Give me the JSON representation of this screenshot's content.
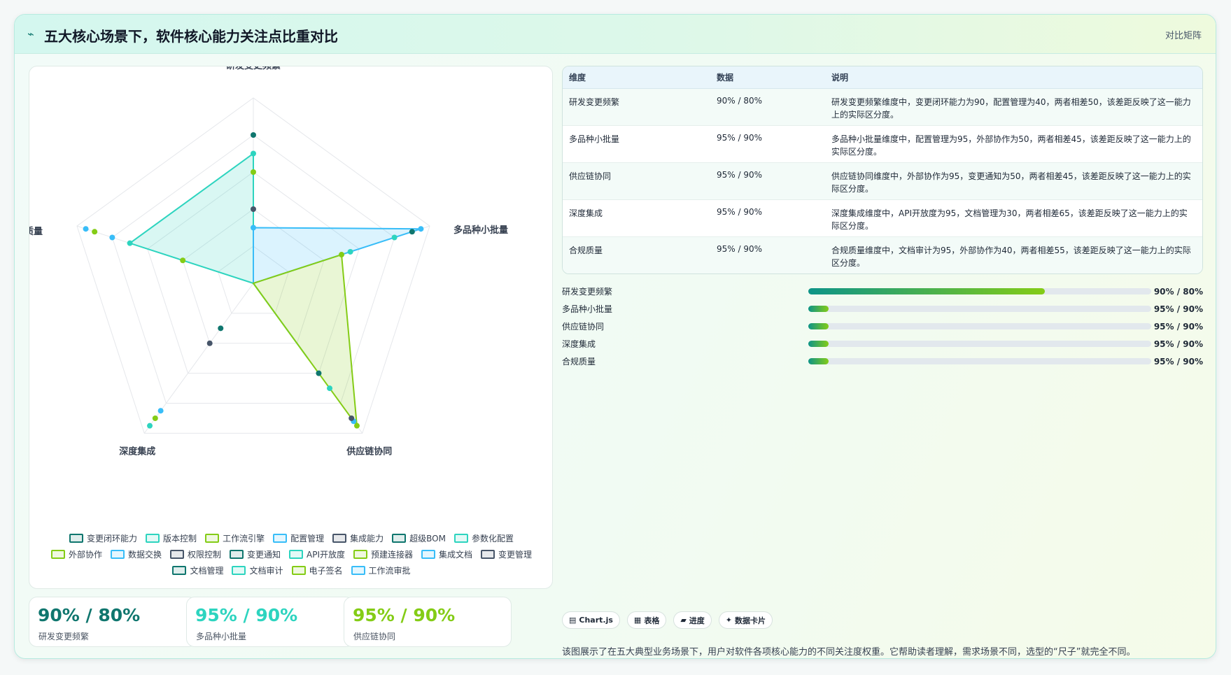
{
  "header": {
    "icon": "wave-icon",
    "title": "五大核心场景下，软件核心能力关注点比重对比",
    "tag": "对比矩阵"
  },
  "colors": {
    "teal_dark": "#0f766e",
    "teal": "#2dd4bf",
    "cyan": "#38bdf8",
    "green": "#84cc16",
    "slate": "#475569"
  },
  "chart_data": {
    "type": "radar",
    "axes": [
      "研发变更频繁",
      "多品种小批量",
      "供应链协同",
      "深度集成",
      "合规质量"
    ],
    "rmax": 100,
    "polygons": [
      {
        "values": [
          70,
          0,
          50,
          0,
          70
        ],
        "color": "#2dd4bf"
      },
      {
        "values": [
          30,
          95,
          0,
          0,
          0
        ],
        "color": "#38bdf8"
      },
      {
        "values": [
          0,
          50,
          95,
          0,
          0
        ],
        "color": "#84cc16"
      }
    ],
    "points": [
      {
        "axis": 0,
        "value": 80,
        "color": "#0f766e"
      },
      {
        "axis": 0,
        "value": 70,
        "color": "#2dd4bf"
      },
      {
        "axis": 0,
        "value": 60,
        "color": "#84cc16"
      },
      {
        "axis": 0,
        "value": 40,
        "color": "#475569"
      },
      {
        "axis": 0,
        "value": 30,
        "color": "#38bdf8"
      },
      {
        "axis": 1,
        "value": 95,
        "color": "#38bdf8"
      },
      {
        "axis": 1,
        "value": 90,
        "color": "#0f766e"
      },
      {
        "axis": 1,
        "value": 80,
        "color": "#2dd4bf"
      },
      {
        "axis": 1,
        "value": 55,
        "color": "#2dd4bf"
      },
      {
        "axis": 1,
        "value": 50,
        "color": "#84cc16"
      },
      {
        "axis": 2,
        "value": 95,
        "color": "#84cc16"
      },
      {
        "axis": 2,
        "value": 92,
        "color": "#38bdf8"
      },
      {
        "axis": 2,
        "value": 90,
        "color": "#475569"
      },
      {
        "axis": 2,
        "value": 70,
        "color": "#2dd4bf"
      },
      {
        "axis": 2,
        "value": 60,
        "color": "#0f766e"
      },
      {
        "axis": 3,
        "value": 95,
        "color": "#2dd4bf"
      },
      {
        "axis": 3,
        "value": 90,
        "color": "#84cc16"
      },
      {
        "axis": 3,
        "value": 85,
        "color": "#38bdf8"
      },
      {
        "axis": 3,
        "value": 40,
        "color": "#475569"
      },
      {
        "axis": 3,
        "value": 30,
        "color": "#0f766e"
      },
      {
        "axis": 4,
        "value": 95,
        "color": "#38bdf8"
      },
      {
        "axis": 4,
        "value": 90,
        "color": "#84cc16"
      },
      {
        "axis": 4,
        "value": 80,
        "color": "#38bdf8"
      },
      {
        "axis": 4,
        "value": 70,
        "color": "#2dd4bf"
      },
      {
        "axis": 4,
        "value": 40,
        "color": "#84cc16"
      }
    ],
    "legend": [
      {
        "name": "变更闭环能力",
        "color": "#0f766e"
      },
      {
        "name": "版本控制",
        "color": "#2dd4bf"
      },
      {
        "name": "工作流引擎",
        "color": "#84cc16"
      },
      {
        "name": "配置管理",
        "color": "#38bdf8"
      },
      {
        "name": "集成能力",
        "color": "#475569"
      },
      {
        "name": "超级BOM",
        "color": "#0f766e"
      },
      {
        "name": "参数化配置",
        "color": "#2dd4bf"
      },
      {
        "name": "外部协作",
        "color": "#84cc16"
      },
      {
        "name": "数据交换",
        "color": "#38bdf8"
      },
      {
        "name": "权限控制",
        "color": "#475569"
      },
      {
        "name": "变更通知",
        "color": "#0f766e"
      },
      {
        "name": "API开放度",
        "color": "#2dd4bf"
      },
      {
        "name": "预建连接器",
        "color": "#84cc16"
      },
      {
        "name": "集成文档",
        "color": "#38bdf8"
      },
      {
        "name": "变更管理",
        "color": "#475569"
      },
      {
        "name": "文档管理",
        "color": "#0f766e"
      },
      {
        "name": "文档审计",
        "color": "#2dd4bf"
      },
      {
        "name": "电子签名",
        "color": "#84cc16"
      },
      {
        "name": "工作流审批",
        "color": "#38bdf8"
      }
    ]
  },
  "table": {
    "headers": [
      "维度",
      "数据",
      "说明"
    ],
    "rows": [
      {
        "dim": "研发变更频繁",
        "data": "90% / 80%",
        "desc": "研发变更频繁维度中，变更闭环能力为90，配置管理为40，两者相差50，该差距反映了这一能力上的实际区分度。"
      },
      {
        "dim": "多品种小批量",
        "data": "95% / 90%",
        "desc": "多品种小批量维度中，配置管理为95，外部协作为50，两者相差45，该差距反映了这一能力上的实际区分度。"
      },
      {
        "dim": "供应链协同",
        "data": "95% / 90%",
        "desc": "供应链协同维度中，外部协作为95，变更通知为50，两者相差45，该差距反映了这一能力上的实际区分度。"
      },
      {
        "dim": "深度集成",
        "data": "95% / 90%",
        "desc": "深度集成维度中，API开放度为95，文档管理为30，两者相差65，该差距反映了这一能力上的实际区分度。"
      },
      {
        "dim": "合规质量",
        "data": "95% / 90%",
        "desc": "合规质量维度中，文档审计为95，外部协作为40，两者相差55，该差距反映了这一能力上的实际区分度。"
      }
    ]
  },
  "progress": [
    {
      "label": "研发变更频繁",
      "fraction": 0.69,
      "value": "90% / 80%"
    },
    {
      "label": "多品种小批量",
      "fraction": 0.06,
      "value": "95% / 90%"
    },
    {
      "label": "供应链协同",
      "fraction": 0.06,
      "value": "95% / 90%"
    },
    {
      "label": "深度集成",
      "fraction": 0.06,
      "value": "95% / 90%"
    },
    {
      "label": "合规质量",
      "fraction": 0.06,
      "value": "95% / 90%"
    }
  ],
  "kpis": [
    {
      "value": "90% / 80%",
      "caption": "研发变更频繁",
      "color": "#0f766e"
    },
    {
      "value": "95% / 90%",
      "caption": "多品种小批量",
      "color": "#2dd4bf"
    },
    {
      "value": "95% / 90%",
      "caption": "供应链协同",
      "color": "#84cc16"
    }
  ],
  "chips": [
    {
      "icon": "chart-icon",
      "glyph": "▤",
      "label": "Chart.js"
    },
    {
      "icon": "table-icon",
      "glyph": "▦",
      "label": "表格"
    },
    {
      "icon": "progress-icon",
      "glyph": "▰",
      "label": "进度"
    },
    {
      "icon": "sparkle-icon",
      "glyph": "✦",
      "label": "数据卡片"
    }
  ],
  "footer_note": "该图展示了在五大典型业务场景下，用户对软件各项核心能力的不同关注度权重。它帮助读者理解，需求场景不同，选型的“尺子”就完全不同。"
}
